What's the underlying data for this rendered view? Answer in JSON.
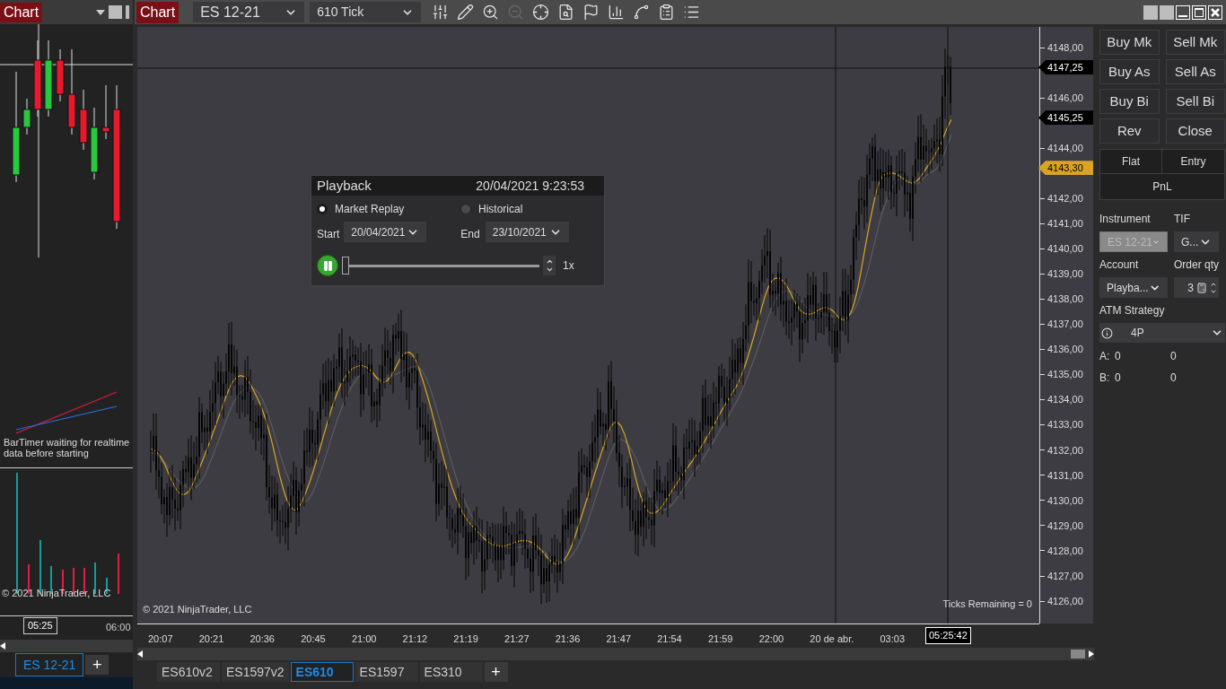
{
  "left_window": {
    "chart_button": "Chart",
    "bar_timer": "BarTimer waiting for realtime data before starting",
    "copyright": "© 2021 NinjaTrader, LLC",
    "time_labels": [
      "06:00"
    ],
    "cursor_time": "05:25",
    "tabs": [
      {
        "label": "ES 12-21",
        "selected": true
      }
    ],
    "add_tab": "+"
  },
  "toolbar": {
    "chart_button": "Chart",
    "instrument": "ES 12-21",
    "interval": "610 Tick",
    "tools": [
      {
        "kind": "sliders",
        "disabled": false
      },
      {
        "kind": "pencil",
        "disabled": false
      },
      {
        "kind": "zoom-in",
        "disabled": false
      },
      {
        "kind": "zoom-out",
        "disabled": true
      },
      {
        "kind": "crosshair",
        "disabled": false
      },
      {
        "kind": "document",
        "disabled": false
      },
      {
        "kind": "flag",
        "disabled": false
      },
      {
        "kind": "bars",
        "disabled": false
      },
      {
        "kind": "spline",
        "disabled": false
      },
      {
        "kind": "clipboard",
        "disabled": false
      },
      {
        "kind": "list",
        "disabled": false
      }
    ]
  },
  "chart": {
    "price_axis": [
      {
        "kind": "tick",
        "text": "4148,00"
      },
      {
        "kind": "tag",
        "color": "#000000",
        "text": "4147,25"
      },
      {
        "kind": "tick",
        "text": "4146,00"
      },
      {
        "kind": "tag",
        "color": "#000000",
        "text": "4145,25"
      },
      {
        "kind": "tick",
        "text": "4144,00"
      },
      {
        "kind": "tag",
        "color": "#dba324",
        "text": "4143,30"
      },
      {
        "kind": "tick",
        "text": "4142,00"
      },
      {
        "kind": "tick",
        "text": "4141,00"
      },
      {
        "kind": "tick",
        "text": "4140,00"
      },
      {
        "kind": "tick",
        "text": "4139,00"
      },
      {
        "kind": "tick",
        "text": "4138,00"
      },
      {
        "kind": "tick",
        "text": "4137,00"
      },
      {
        "kind": "tick",
        "text": "4136,00"
      },
      {
        "kind": "tick",
        "text": "4135,00"
      },
      {
        "kind": "tick",
        "text": "4134,00"
      },
      {
        "kind": "tick",
        "text": "4133,00"
      },
      {
        "kind": "tick",
        "text": "4132,00"
      },
      {
        "kind": "tick",
        "text": "4131,00"
      },
      {
        "kind": "tick",
        "text": "4130,00"
      },
      {
        "kind": "tick",
        "text": "4129,00"
      },
      {
        "kind": "tick",
        "text": "4128,00"
      },
      {
        "kind": "tick",
        "text": "4127,00"
      },
      {
        "kind": "tick",
        "text": "4126,00"
      }
    ],
    "time_labels": [
      "20:07",
      "20:21",
      "20:36",
      "20:45",
      "21:00",
      "21:12",
      "21:19",
      "21:27",
      "21:36",
      "21:47",
      "21:54",
      "21:59",
      "22:00",
      "20 de abr.",
      "03:03"
    ],
    "cursor_time": "05:25:42",
    "copyright": "© 2021 NinjaTrader, LLC",
    "ticks_remaining": "Ticks Remaining = 0"
  },
  "playback": {
    "title": "Playback",
    "timestamp": "20/04/2021 9:23:53",
    "modes": [
      {
        "label": "Market Replay",
        "selected": true
      },
      {
        "label": "Historical",
        "selected": false
      }
    ],
    "start_label": "Start",
    "start_date": "20/04/2021",
    "end_label": "End",
    "end_date": "23/10/2021",
    "playing": true,
    "level": 0,
    "speed": "1x"
  },
  "tabs": [
    {
      "label": "ES610v2",
      "selected": false
    },
    {
      "label": "ES1597v2",
      "selected": false
    },
    {
      "label": "ES610",
      "selected": true
    },
    {
      "label": "ES1597",
      "selected": false
    },
    {
      "label": "ES310",
      "selected": false
    }
  ],
  "add_tab": "+",
  "order_panel": {
    "buttons": [
      "Buy Mk",
      "Sell Mk",
      "Buy As",
      "Sell As",
      "Buy Bi",
      "Sell Bi",
      "Rev",
      "Close"
    ],
    "flat": "Flat",
    "entry": "Entry",
    "pnl": "PnL",
    "instrument_label": "Instrument",
    "instrument": {
      "value": "ES 12-21",
      "disabled": true
    },
    "tif_label": "TIF",
    "tif": "G...",
    "account_label": "Account",
    "account": "Playba...",
    "qty_label": "Order qty",
    "qty": "3",
    "atm_label": "ATM Strategy",
    "atm": "4P",
    "positions": [
      {
        "label": "A:",
        "values": [
          "0",
          "0"
        ]
      },
      {
        "label": "B:",
        "values": [
          "0",
          "0"
        ]
      }
    ]
  }
}
